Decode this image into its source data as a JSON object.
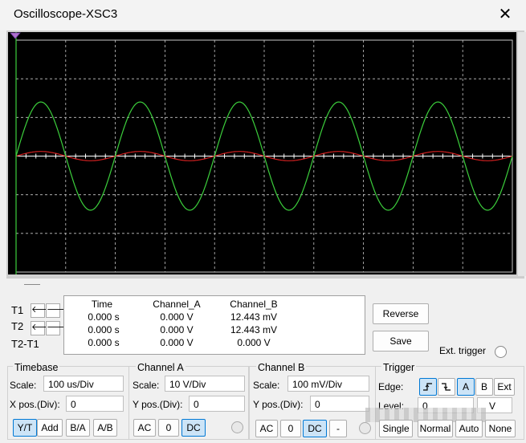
{
  "window": {
    "title": "Oscilloscope-XSC3",
    "close_glyph": "✕"
  },
  "screen": {
    "bg": "#000000",
    "grid_color": "#c8c8c8",
    "trace_a_color": "#3ccf3c",
    "trace_b_color": "#d02020",
    "cursor_color": "#3ccf3c",
    "cursor_marker_icon": "cursor-marker-icon",
    "channel_a_amplitude_div": 1.4,
    "channel_b_amplitude_div": 0.12,
    "periods_visible": 5
  },
  "cursors": {
    "t1_label": "T1",
    "t2_label": "T2",
    "t2t1_label": "T2-T1",
    "left_arrow": "🡐",
    "right_arrow": "🡒"
  },
  "readout": {
    "headers": [
      "Time",
      "Channel_A",
      "Channel_B"
    ],
    "rows": [
      [
        "0.000 s",
        "0.000 V",
        "12.443 mV"
      ],
      [
        "0.000 s",
        "0.000 V",
        "12.443 mV"
      ],
      [
        "0.000 s",
        "0.000 V",
        "0.000 V"
      ]
    ]
  },
  "actions": {
    "reverse": "Reverse",
    "save": "Save",
    "ext_trigger": "Ext. trigger"
  },
  "timebase": {
    "title": "Timebase",
    "scale_label": "Scale:",
    "scale_value": "100 us/Div",
    "xpos_label": "X pos.(Div):",
    "xpos_value": "0",
    "modes": [
      "Y/T",
      "Add",
      "B/A",
      "A/B"
    ],
    "selected_mode": "Y/T"
  },
  "channel_a": {
    "title": "Channel A",
    "scale_label": "Scale:",
    "scale_value": "10  V/Div",
    "ypos_label": "Y pos.(Div):",
    "ypos_value": "0",
    "coupling": [
      "AC",
      "0",
      "DC"
    ],
    "selected_coupling": "DC"
  },
  "channel_b": {
    "title": "Channel B",
    "scale_label": "Scale:",
    "scale_value": "100 mV/Div",
    "ypos_label": "Y pos.(Div):",
    "ypos_value": "0",
    "coupling": [
      "AC",
      "0",
      "DC",
      "-"
    ],
    "selected_coupling": "DC"
  },
  "trigger": {
    "title": "Trigger",
    "edge_label": "Edge:",
    "edge_rise_icon": "rising-edge-icon",
    "edge_fall_icon": "falling-edge-icon",
    "edge_sources": [
      "A",
      "B",
      "Ext"
    ],
    "selected_source": "A",
    "level_label": "Level:",
    "level_value": "0",
    "level_unit": "V",
    "modes": [
      "Single",
      "Normal",
      "Auto",
      "None"
    ]
  }
}
